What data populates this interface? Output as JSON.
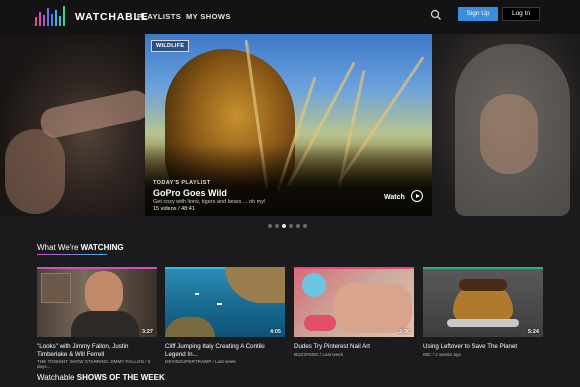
{
  "header": {
    "brand": "WATCHABLE",
    "nav": [
      "PLAYLISTS",
      "MY SHOWS"
    ],
    "signup": "Sign Up",
    "login": "Log In"
  },
  "hero": {
    "tag": "WILDLIFE",
    "playlist_label": "TODAY'S PLAYLIST",
    "title": "GoPro Goes Wild",
    "description": "Get cozy with lions, tigers and bears ... oh my!",
    "count": "15 videos / 48:41",
    "watch": "Watch",
    "active_dot_index": 2,
    "dot_count": 6
  },
  "section": {
    "prefix": "What We're ",
    "emphasis": "WATCHING"
  },
  "cards": [
    {
      "title": "\"Looks\" with Jimmy Fallon, Justin Timberlake & Will Ferrell",
      "source": "THE TONIGHT SHOW STARRING JIMMY FALLON",
      "age": "5 days...",
      "duration": "3:27",
      "bar_color": "#d24fc3"
    },
    {
      "title": "Cliff Jumping Italy Creating A Contiki Legend In...",
      "source": "DEVINSUPERTRAMP",
      "age": "Last week",
      "duration": "4:05",
      "bar_color": "#34b8e8"
    },
    {
      "title": "Dudes Try Pinterest Nail Art",
      "source": "BUZZFEED",
      "age": "Last week",
      "duration": "2:36",
      "bar_color": "#e84a7a"
    },
    {
      "title": "Using Leftover to Save The Planet",
      "source": "MIC",
      "age": "2 weeks ago",
      "duration": "5:24",
      "bar_color": "#2fb07a"
    }
  ],
  "bottom": {
    "prefix": "Watchable ",
    "emphasis": "SHOWS OF THE WEEK"
  },
  "colors": {
    "signup": "#3a8ede",
    "background": "#1b1b1d",
    "header": "#131315"
  }
}
